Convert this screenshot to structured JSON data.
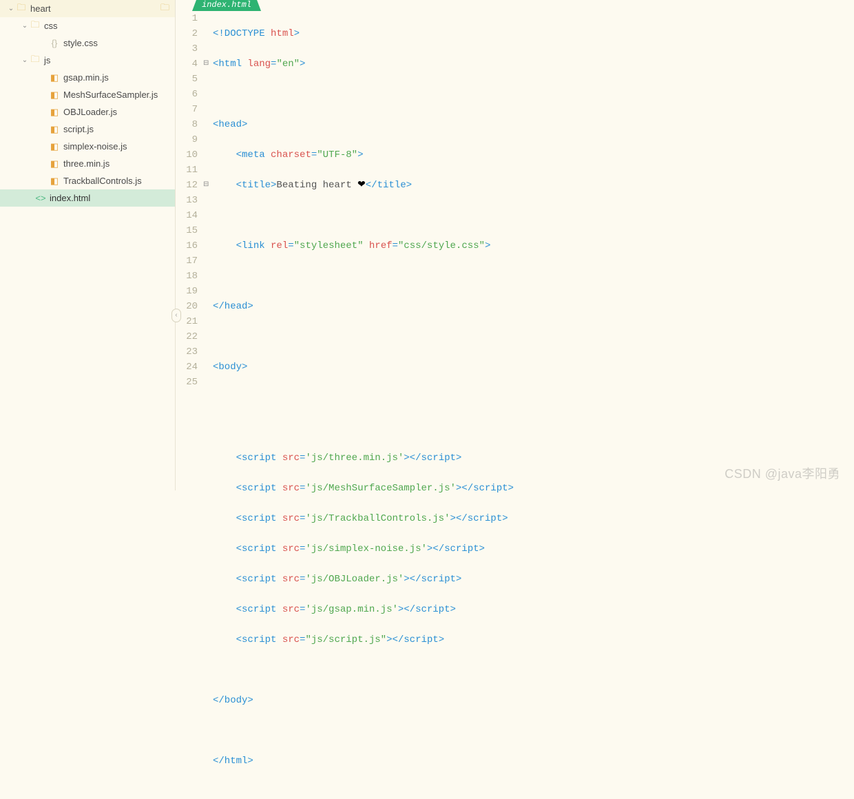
{
  "tab": {
    "name": "index.html"
  },
  "tree": {
    "root": {
      "name": "heart"
    },
    "css": {
      "name": "css"
    },
    "style": {
      "name": "style.css"
    },
    "js": {
      "name": "js"
    },
    "gsap": {
      "name": "gsap.min.js"
    },
    "mesh": {
      "name": "MeshSurfaceSampler.js"
    },
    "objl": {
      "name": "OBJLoader.js"
    },
    "script": {
      "name": "script.js"
    },
    "simplex": {
      "name": "simplex-noise.js"
    },
    "three": {
      "name": "three.min.js"
    },
    "trackball": {
      "name": "TrackballControls.js"
    },
    "index": {
      "name": "index.html"
    }
  },
  "code": {
    "l1": {
      "a": "<!DOCTYPE ",
      "b": "html",
      "c": ">"
    },
    "l2": {
      "a": "<html ",
      "b": "lang",
      "c": "=",
      "d": "\"en\"",
      "e": ">"
    },
    "l4": {
      "a": "<head>"
    },
    "l5": {
      "a": "<meta ",
      "b": "charset",
      "c": "=",
      "d": "\"UTF-8\"",
      "e": ">"
    },
    "l6": {
      "a": "<title>",
      "b": "Beating heart ",
      "c": "❤",
      "d": "</title>"
    },
    "l8": {
      "a": "<link ",
      "b": "rel",
      "c": "=",
      "d": "\"stylesheet\"",
      "e": " ",
      "f": "href",
      "g": "=",
      "h": "\"css/style.css\"",
      "i": ">"
    },
    "l10": {
      "a": "</head>"
    },
    "l12": {
      "a": "<body>"
    },
    "l15": {
      "a": "<script ",
      "b": "src",
      "c": "=",
      "d": "'js/three.min.js'",
      "e": "></script",
      "f": ">"
    },
    "l16": {
      "a": "<script ",
      "b": "src",
      "c": "=",
      "d": "'js/MeshSurfaceSampler.js'",
      "e": "></script",
      "f": ">"
    },
    "l17": {
      "a": "<script ",
      "b": "src",
      "c": "=",
      "d": "'js/TrackballControls.js'",
      "e": "></script",
      "f": ">"
    },
    "l18": {
      "a": "<script ",
      "b": "src",
      "c": "=",
      "d": "'js/simplex-noise.js'",
      "e": "></script",
      "f": ">"
    },
    "l19": {
      "a": "<script ",
      "b": "src",
      "c": "=",
      "d": "'js/OBJLoader.js'",
      "e": "></script",
      "f": ">"
    },
    "l20": {
      "a": "<script ",
      "b": "src",
      "c": "=",
      "d": "'js/gsap.min.js'",
      "e": "></script",
      "f": ">"
    },
    "l21": {
      "a": "<script ",
      "b": "src",
      "c": "=",
      "d": "\"js/script.js\"",
      "e": "></script",
      "f": ">"
    },
    "l23": {
      "a": "</body>"
    },
    "l25": {
      "a": "</html>"
    }
  },
  "lines": [
    "1",
    "2",
    "3",
    "4",
    "5",
    "6",
    "7",
    "8",
    "9",
    "10",
    "11",
    "12",
    "13",
    "14",
    "15",
    "16",
    "17",
    "18",
    "19",
    "20",
    "21",
    "22",
    "23",
    "24",
    "25"
  ],
  "watermark": "CSDN @java李阳勇"
}
